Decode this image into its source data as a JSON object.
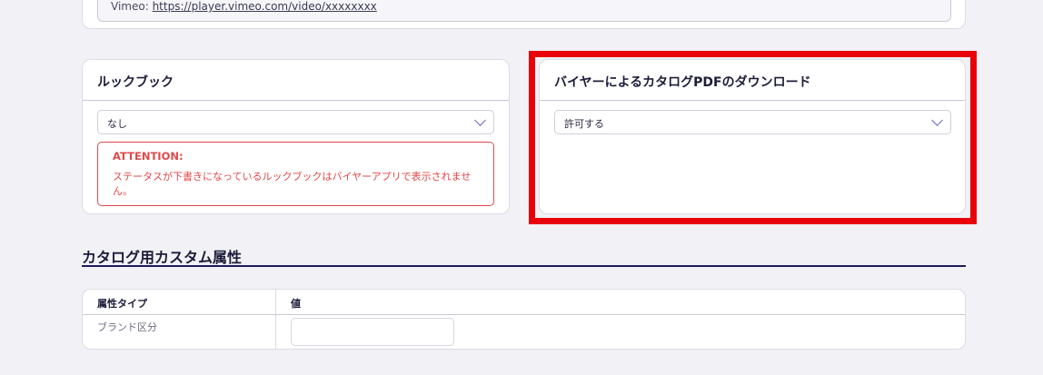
{
  "video": {
    "prefix": "Vimeo: ",
    "url": "https://player.vimeo.com/video/xxxxxxxx"
  },
  "lookbook": {
    "title": "ルックブック",
    "selected": "なし",
    "attention_title": "ATTENTION:",
    "attention_text": "ステータスが下書きになっているルックブックはバイヤーアプリで表示されません。"
  },
  "pdf_download": {
    "title": "バイヤーによるカタログPDFのダウンロード",
    "selected": "許可する"
  },
  "custom_attributes": {
    "section_title": "カタログ用カスタム属性",
    "columns": [
      "属性タイプ",
      "値"
    ],
    "rows": [
      {
        "type": "ブランド区分",
        "value": ""
      }
    ]
  },
  "colors": {
    "highlight": "#e8000a",
    "attention": "#e0484a",
    "accent": "#6b64c7"
  }
}
